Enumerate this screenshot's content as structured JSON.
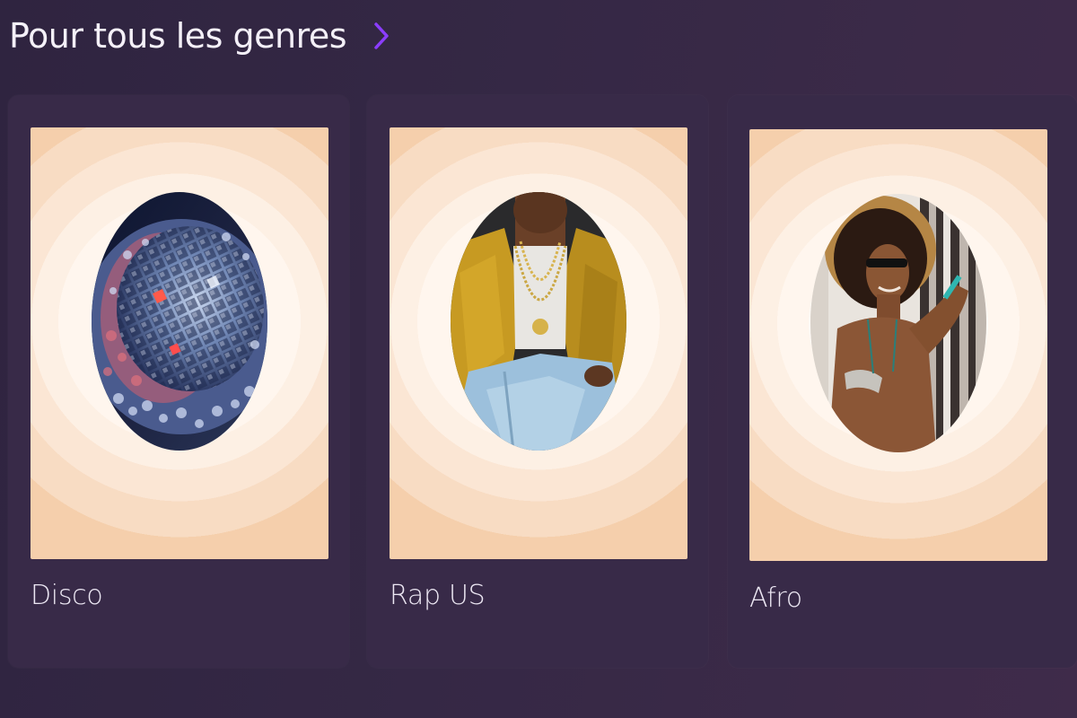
{
  "section": {
    "title": "Pour tous les genres",
    "more_icon": "chevron-right-icon",
    "accent_color": "#8b3dff"
  },
  "genres": [
    {
      "label": "Disco",
      "image": "disco-ball-photo"
    },
    {
      "label": "Rap US",
      "image": "rapper-photo"
    },
    {
      "label": "Afro",
      "image": "afro-woman-photo"
    }
  ]
}
